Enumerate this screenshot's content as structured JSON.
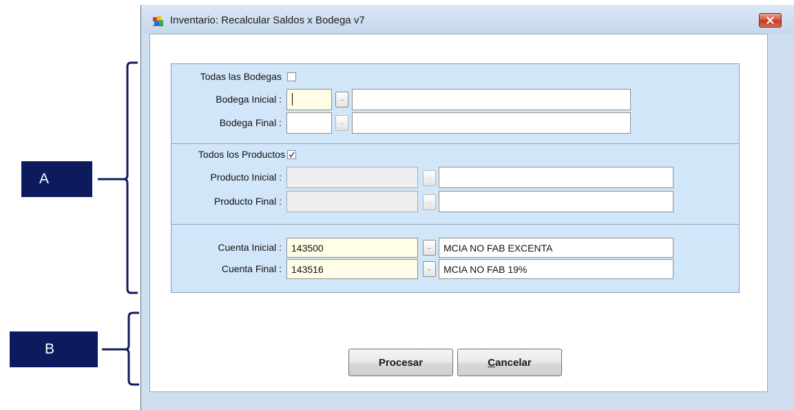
{
  "window": {
    "title": "Inventario: Recalcular Saldos x Bodega v7"
  },
  "icons": {
    "app": "app-icon",
    "close": "close-icon",
    "check": "checkmark-icon"
  },
  "bodegas": {
    "todas_label": "Todas las Bodegas",
    "todas_checked": false,
    "inicial_label": "Bodega Inicial :",
    "inicial_code": "",
    "inicial_desc": "",
    "final_label": "Bodega Final :",
    "final_code": "",
    "final_desc": ""
  },
  "productos": {
    "todos_label": "Todos los Productos",
    "todos_checked": true,
    "inicial_label": "Producto Inicial :",
    "inicial_code": "",
    "inicial_desc": "",
    "final_label": "Producto Final :",
    "final_code": "",
    "final_desc": ""
  },
  "cuentas": {
    "inicial_label": "Cuenta Inicial :",
    "inicial_code": "143500",
    "inicial_desc": "MCIA NO FAB EXCENTA",
    "final_label": "Cuenta Final :",
    "final_code": "143516",
    "final_desc": "MCIA NO FAB 19%"
  },
  "lookup_label": "..",
  "buttons": {
    "procesar": "Procesar",
    "cancelar_mnemonic": "C",
    "cancelar_rest": "ancelar"
  },
  "annotations": {
    "a": "A",
    "b": "B"
  },
  "colors": {
    "callout": "#0e1a5e",
    "panel": "#d2e6f9",
    "required_field": "#fffde6",
    "close_button": "#d9553f"
  }
}
